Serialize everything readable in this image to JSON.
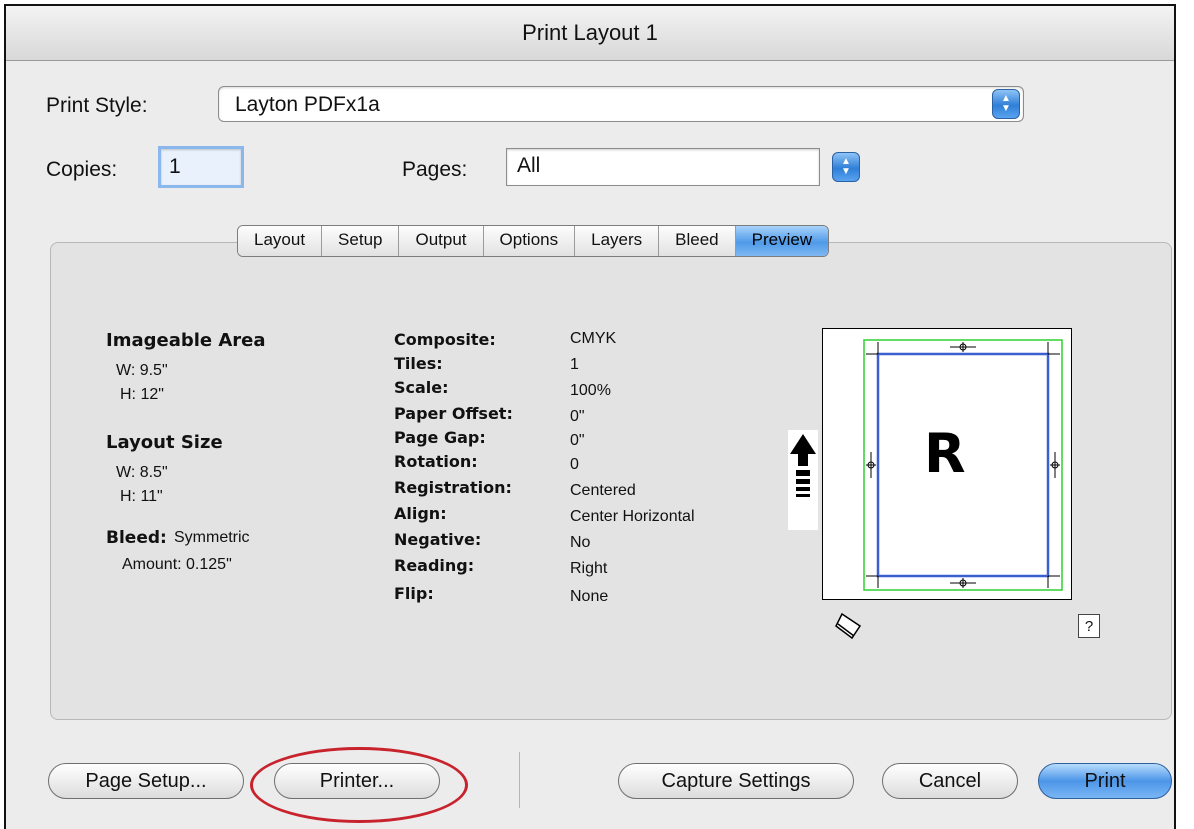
{
  "window": {
    "title": "Print Layout 1"
  },
  "print_style": {
    "label": "Print Style:",
    "value": "Layton PDFx1a"
  },
  "copies": {
    "label": "Copies:",
    "value": "1"
  },
  "pages": {
    "label": "Pages:",
    "value": "All"
  },
  "tabs": [
    "Layout",
    "Setup",
    "Output",
    "Options",
    "Layers",
    "Bleed",
    "Preview"
  ],
  "active_tab": "Preview",
  "left_info": {
    "imageable_area_title": "Imageable Area",
    "imageable_w": "W: 9.5\"",
    "imageable_h": "H: 12\"",
    "layout_size_title": "Layout Size",
    "layout_w": "W: 8.5\"",
    "layout_h": "H: 11\"",
    "bleed_label": "Bleed:",
    "bleed_value": "Symmetric",
    "amount": "Amount: 0.125\""
  },
  "details": [
    {
      "key": "Composite:",
      "value": "CMYK"
    },
    {
      "key": "Tiles:",
      "value": "1"
    },
    {
      "key": "Scale:",
      "value": "100%"
    },
    {
      "key": "Paper Offset:",
      "value": "0\""
    },
    {
      "key": "Page Gap:",
      "value": "0\""
    },
    {
      "key": "Rotation:",
      "value": "0"
    },
    {
      "key": "Registration:",
      "value": "Centered"
    },
    {
      "key": "Align:",
      "value": "Center Horizontal"
    },
    {
      "key": "Negative:",
      "value": "No"
    },
    {
      "key": "Reading:",
      "value": "Right"
    },
    {
      "key": "Flip:",
      "value": "None"
    }
  ],
  "preview": {
    "page_letter": "R",
    "help": "?",
    "icons": [
      "up-arrow-icon",
      "eraser-icon",
      "crosshair-icon"
    ]
  },
  "buttons": {
    "page_setup": "Page Setup...",
    "printer": "Printer...",
    "capture_settings": "Capture Settings",
    "cancel": "Cancel",
    "print": "Print"
  },
  "colors": {
    "accent": "#4c96e8",
    "highlight_oval": "#c8222c",
    "trim_box": "#3b5fd0",
    "bleed_box": "#2fd02f"
  }
}
